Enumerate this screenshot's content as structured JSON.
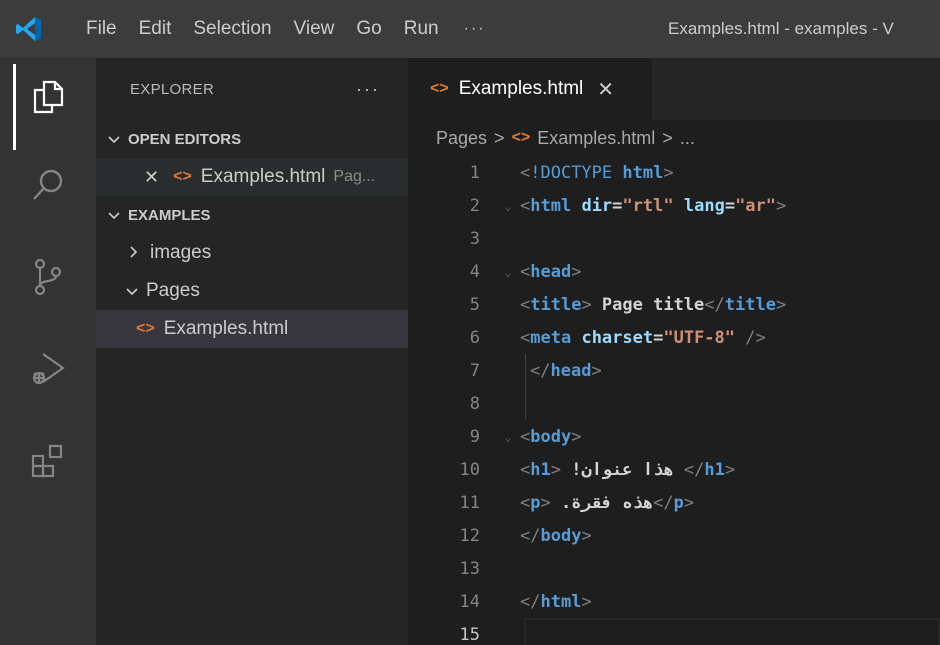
{
  "titlebar": {
    "menu": [
      "File",
      "Edit",
      "Selection",
      "View",
      "Go",
      "Run"
    ],
    "more": "···",
    "window_title": "Examples.html - examples - V"
  },
  "activity": [
    "explorer-icon",
    "search-icon",
    "source-control-icon",
    "run-debug-icon",
    "extensions-icon"
  ],
  "sidebar": {
    "title": "EXPLORER",
    "more": "···",
    "open_editors": {
      "label": "OPEN EDITORS",
      "items": [
        {
          "close": "✕",
          "icon": "<>",
          "name": "Examples.html",
          "dir": "Pag..."
        }
      ]
    },
    "workspace": {
      "label": "EXAMPLES",
      "items": [
        {
          "chevron": "›",
          "name": "images"
        },
        {
          "chevron": "⌄",
          "name": "Pages"
        },
        {
          "icon": "<>",
          "name": "Examples.html"
        }
      ]
    }
  },
  "editor": {
    "tab": {
      "icon": "<>",
      "label": "Examples.html",
      "close": "✕"
    },
    "breadcrumb": {
      "folder": "Pages",
      "sep": ">",
      "icon": "<>",
      "file": "Examples.html",
      "sep2": ">",
      "more": "..."
    },
    "current_line": 15,
    "lines": [
      {
        "n": "1",
        "text": "<!DOCTYPE html>"
      },
      {
        "n": "2",
        "text": "<html dir=\"rtl\" lang=\"ar\">"
      },
      {
        "n": "3",
        "text": ""
      },
      {
        "n": "4",
        "text": "<head>"
      },
      {
        "n": "5",
        "text": "<title> Page title</title>"
      },
      {
        "n": "6",
        "text": "<meta charset=\"UTF-8\" />"
      },
      {
        "n": "7",
        "text": "</head>"
      },
      {
        "n": "8",
        "text": ""
      },
      {
        "n": "9",
        "text": "<body>"
      },
      {
        "n": "10",
        "text": "<h1> !هذا عنوان </h1>"
      },
      {
        "n": "11",
        "text": "<p> .هذه فقرة</p>"
      },
      {
        "n": "12",
        "text": "</body>"
      },
      {
        "n": "13",
        "text": ""
      },
      {
        "n": "14",
        "text": "</html>"
      },
      {
        "n": "15",
        "text": ""
      }
    ]
  },
  "colors": {
    "titlebar": "#3c3c3c",
    "activitybar": "#333333",
    "sidebar": "#252526",
    "editor": "#1e1e1e",
    "vscode_blue": "#007acc",
    "html_icon": "#e37933",
    "tag": "#569cd6",
    "attr": "#9cdcfe",
    "string": "#ce9178"
  }
}
